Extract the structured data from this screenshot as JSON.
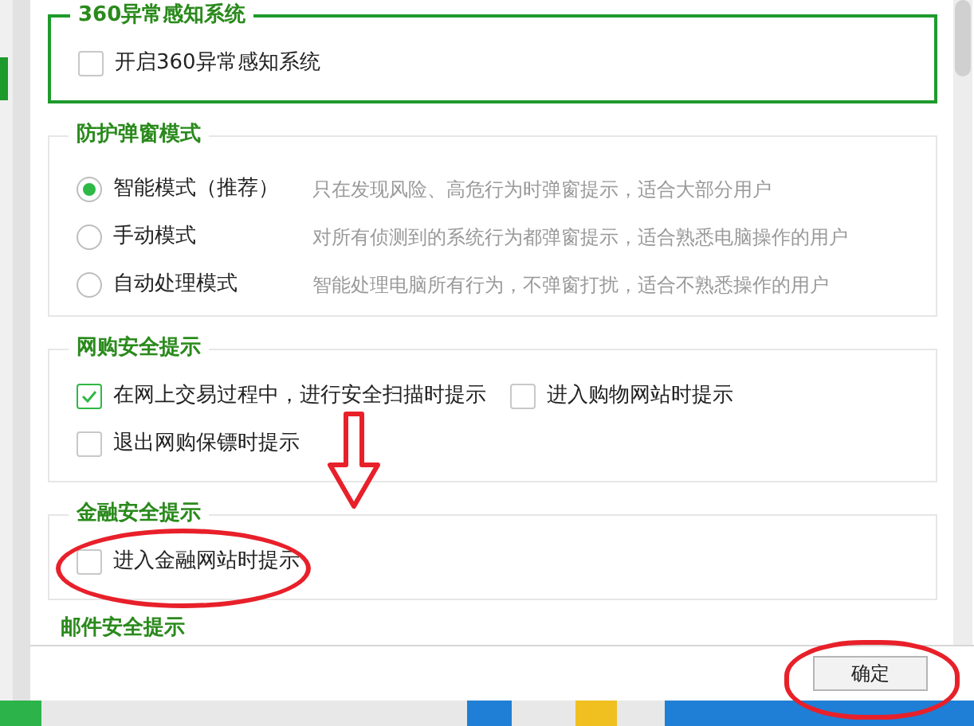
{
  "sections": [
    {
      "kind": "checks",
      "title": "360异常感知系统",
      "highlighted": true,
      "items": [
        {
          "label": "开启360异常感知系统",
          "checked": false
        }
      ]
    },
    {
      "kind": "radios",
      "title": "防护弹窗模式",
      "highlighted": false,
      "items": [
        {
          "label": "智能模式（推荐）",
          "description": "只在发现风险、高危行为时弹窗提示，适合大部分用户",
          "selected": true
        },
        {
          "label": "手动模式",
          "description": "对所有侦测到的系统行为都弹窗提示，适合熟悉电脑操作的用户",
          "selected": false
        },
        {
          "label": "自动处理模式",
          "description": "智能处理电脑所有行为，不弹窗打扰，适合不熟悉操作的用户",
          "selected": false
        }
      ]
    },
    {
      "kind": "checks",
      "title": "网购安全提示",
      "highlighted": false,
      "items": [
        {
          "label": "在网上交易过程中，进行安全扫描时提示",
          "checked": true
        },
        {
          "label": "进入购物网站时提示",
          "checked": false
        },
        {
          "label": "退出网购保镖时提示",
          "checked": false
        }
      ]
    },
    {
      "kind": "checks",
      "title": "金融安全提示",
      "highlighted": false,
      "items": [
        {
          "label": "进入金融网站时提示",
          "checked": false
        }
      ]
    },
    {
      "kind": "heading",
      "title": "邮件安全提示"
    }
  ],
  "footer": {
    "ok_button": "确定"
  }
}
